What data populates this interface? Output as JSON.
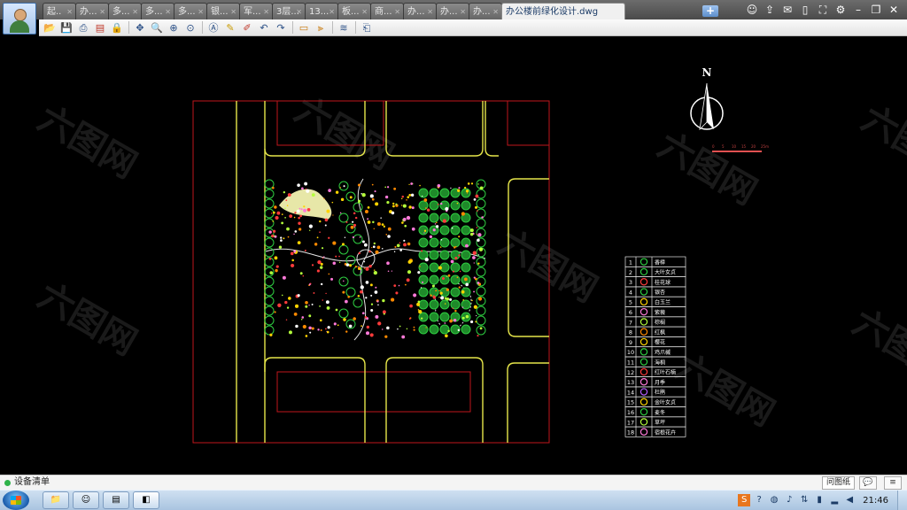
{
  "tabs": [
    {
      "label": "起.."
    },
    {
      "label": "办..."
    },
    {
      "label": "多..."
    },
    {
      "label": "多..."
    },
    {
      "label": "多..."
    },
    {
      "label": "银..."
    },
    {
      "label": "军..."
    },
    {
      "label": "3层..."
    },
    {
      "label": "13..."
    },
    {
      "label": "板..."
    },
    {
      "label": "商..."
    },
    {
      "label": "办..."
    },
    {
      "label": "办..."
    },
    {
      "label": "办..."
    },
    {
      "label": "办公楼前绿化设计.dwg"
    }
  ],
  "new_tab_label": "+",
  "window_icons": [
    "users-icon",
    "share-icon",
    "chat-icon",
    "phone-icon",
    "fullscreen-icon",
    "settings-icon",
    "minimize-icon",
    "restore-icon",
    "close-icon"
  ],
  "toolbar_icons": [
    "open-icon",
    "save-icon",
    "print-icon",
    "pdf-icon",
    "lock-icon",
    "pan-icon",
    "zoom-window-icon",
    "zoom-realtime-icon",
    "zoom-extents-icon",
    "text-icon",
    "pencil-icon",
    "markup-icon",
    "undo-icon",
    "redo-icon",
    "layer-icon",
    "measure-icon",
    "layers-stack-icon",
    "export-icon"
  ],
  "drawing": {
    "north_label": "N",
    "scale_bar_ticks": [
      "0",
      "5",
      "10",
      "15",
      "20",
      "25m"
    ],
    "legend": [
      {
        "no": "1",
        "name": "香樟"
      },
      {
        "no": "2",
        "name": "大叶女贞"
      },
      {
        "no": "3",
        "name": "桂花球"
      },
      {
        "no": "4",
        "name": "银杏"
      },
      {
        "no": "5",
        "name": "白玉兰"
      },
      {
        "no": "6",
        "name": "紫薇"
      },
      {
        "no": "7",
        "name": "棕榈"
      },
      {
        "no": "8",
        "name": "红枫"
      },
      {
        "no": "9",
        "name": "樱花"
      },
      {
        "no": "10",
        "name": "鸡爪槭"
      },
      {
        "no": "11",
        "name": "海桐"
      },
      {
        "no": "12",
        "name": "红叶石楠"
      },
      {
        "no": "13",
        "name": "月季"
      },
      {
        "no": "14",
        "name": "杜鹃"
      },
      {
        "no": "15",
        "name": "金叶女贞"
      },
      {
        "no": "16",
        "name": "麦冬"
      },
      {
        "no": "17",
        "name": "草坪"
      },
      {
        "no": "18",
        "name": "宿根花卉"
      }
    ],
    "watermark": "六图网"
  },
  "status": {
    "device_list": "设备清单",
    "question_button": "问图纸",
    "chat_icon": "chat-icon"
  },
  "taskbar": {
    "clock": "21:46",
    "buttons": [
      "explorer-icon",
      "avatar-app-icon",
      "winrar-icon",
      "cad-viewer-icon"
    ],
    "tray_icons": [
      "s-icon",
      "help-icon",
      "qq-icon",
      "speaker-icon",
      "network-icon",
      "battery-icon",
      "signal-icon",
      "volume-icon"
    ]
  }
}
